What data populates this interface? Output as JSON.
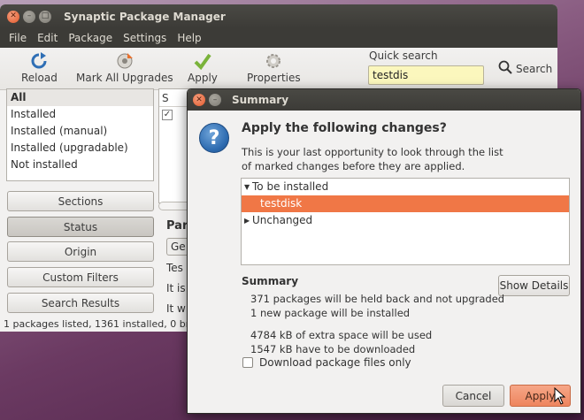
{
  "window": {
    "title": "Synaptic Package Manager"
  },
  "menu": [
    "File",
    "Edit",
    "Package",
    "Settings",
    "Help"
  ],
  "toolbar": {
    "reload": "Reload",
    "mark_all": "Mark All Upgrades",
    "apply": "Apply",
    "properties": "Properties",
    "quick_search_label": "Quick search",
    "quick_search_value": "testdis",
    "search": "Search"
  },
  "filters": [
    "All",
    "Installed",
    "Installed (manual)",
    "Installed (upgradable)",
    "Not installed"
  ],
  "side_buttons": {
    "sections": "Sections",
    "status": "Status",
    "origin": "Origin",
    "custom_filters": "Custom Filters",
    "search_results": "Search Results"
  },
  "package_list": {
    "column_s": "S"
  },
  "description": {
    "heading": "Par",
    "tab": "Ge",
    "lines": [
      "Tes",
      "It is",
      "It w"
    ]
  },
  "statusbar": "1 packages listed, 1361 installed, 0 br",
  "dialog": {
    "title": "Summary",
    "heading": "Apply the following changes?",
    "description": "This is your last opportunity to look through the list of marked changes before they are applied.",
    "tree": {
      "to_be_installed": "To be installed",
      "package": "testdisk",
      "unchanged": "Unchanged"
    },
    "summary_label": "Summary",
    "show_details": "Show Details",
    "lines": {
      "held_back": "371 packages will be held back and not upgraded",
      "new_package": "1 new package will be installed",
      "extra_space": "4784 kB of extra space will be used",
      "download": "1547 kB have to be downloaded"
    },
    "download_only": "Download package files only",
    "cancel": "Cancel",
    "apply": "Apply"
  },
  "colors": {
    "accent": "#f07746",
    "titlebar": "#3c3b37",
    "search_bg": "#fbf7bd"
  }
}
